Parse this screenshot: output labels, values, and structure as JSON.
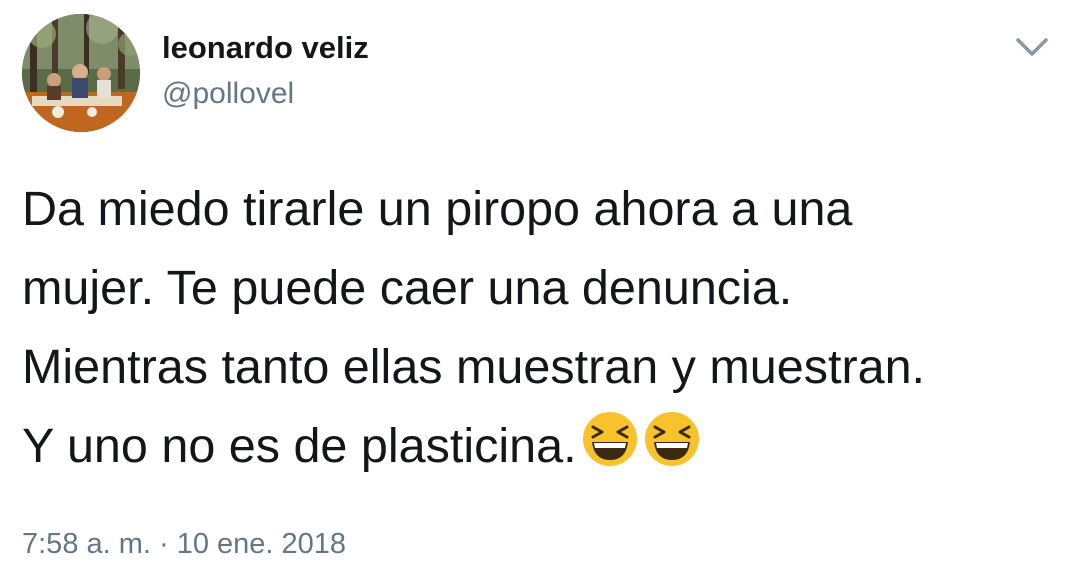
{
  "author": {
    "display_name": "leonardo veliz",
    "handle": "@pollovel",
    "avatar_icon": "profile-photo"
  },
  "menu": {
    "icon": "chevron-down-icon"
  },
  "tweet": {
    "lines": [
      "Da miedo tirarle un piropo ahora a una",
      "mujer. Te puede caer una denuncia.",
      "Mientras tanto ellas muestran y muestran.",
      "Y uno no es de plasticina."
    ],
    "emojis": [
      "grinning-squinting-face-emoji",
      "grinning-squinting-face-emoji"
    ]
  },
  "timestamp": "7:58 a. m. · 10 ene. 2018",
  "colors": {
    "text_primary": "#14171a",
    "text_secondary": "#657786",
    "emoji_yellow": "#f7c22b",
    "chevron": "#8899a6"
  }
}
